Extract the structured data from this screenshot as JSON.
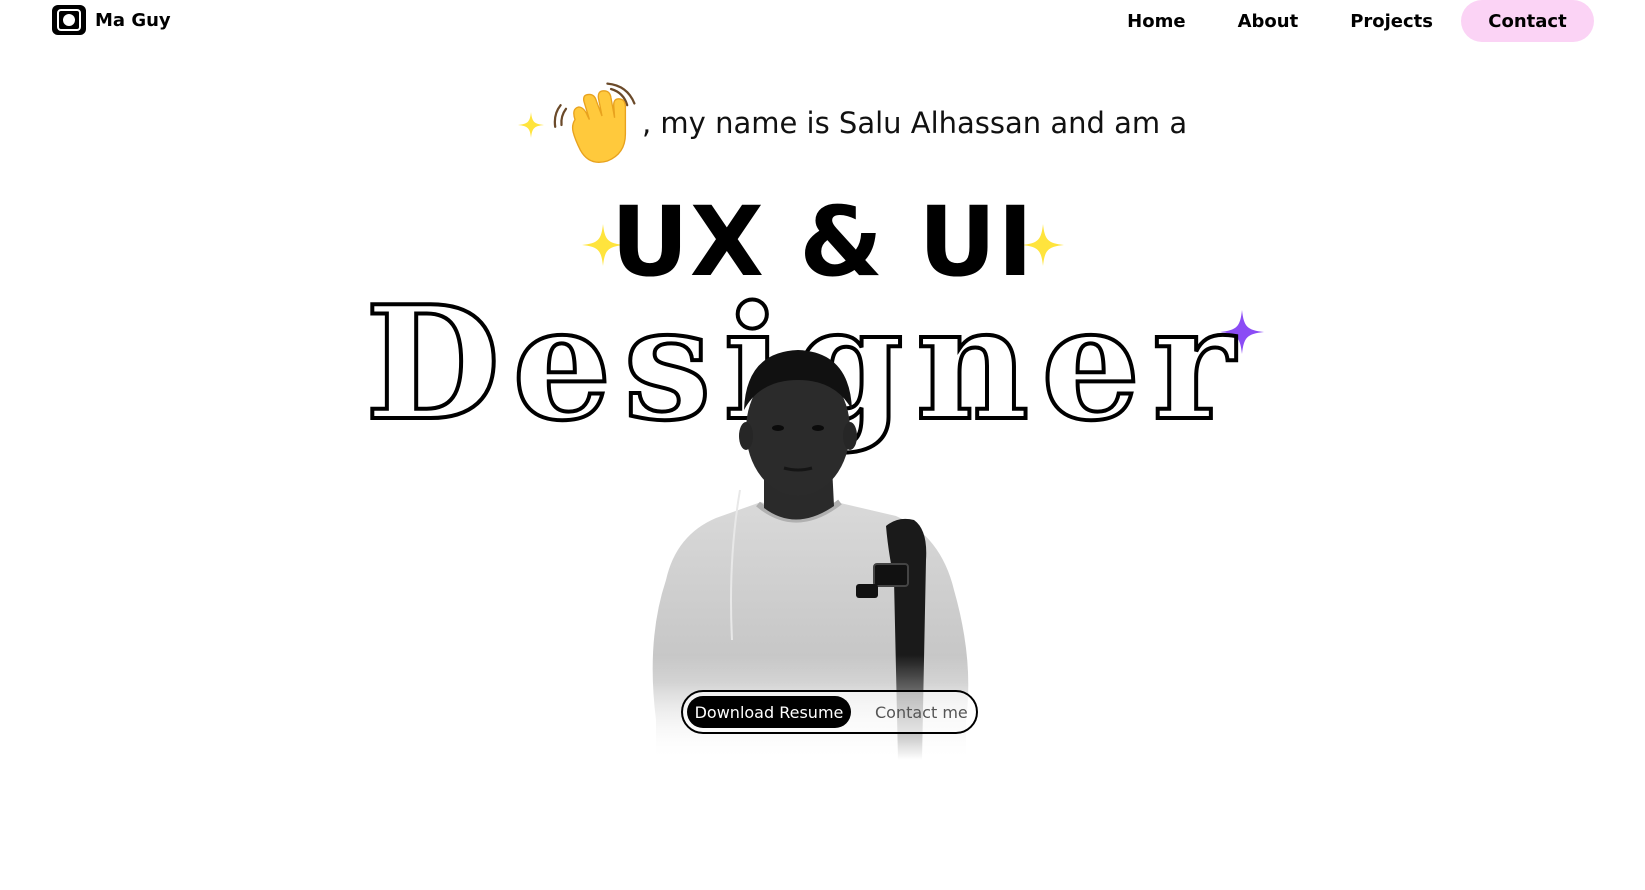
{
  "brand": {
    "name": "Ma Guy",
    "icon": "logo-camera-icon"
  },
  "nav": {
    "items": [
      {
        "label": "Home"
      },
      {
        "label": "About"
      },
      {
        "label": "Projects"
      }
    ],
    "cta": {
      "label": "Contact",
      "color": "#fbd3f5"
    }
  },
  "hero": {
    "greeting": ", my name is Salu Alhassan and am a",
    "wave_icon": "waving-hand-icon",
    "role": "UX & UI",
    "title": "Designer",
    "portrait": "portrait-photo",
    "actions": {
      "primary": "Download Resume",
      "secondary": "Contact me"
    }
  },
  "colors": {
    "sparkle_yellow": "#ffe43d",
    "sparkle_purple": "#8b4cf5",
    "accent_pink": "#fbd3f5"
  }
}
